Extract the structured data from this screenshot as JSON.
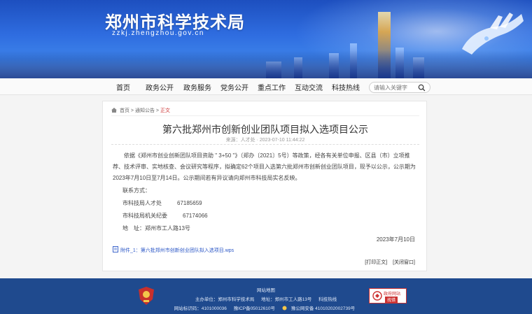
{
  "header": {
    "title": "郑州市科学技术局",
    "domain": "zzkj.zhengzhou.gov.cn"
  },
  "nav": {
    "items": [
      "首页",
      "政务公开",
      "政务服务",
      "党务公开",
      "重点工作",
      "互动交流",
      "科技热线"
    ],
    "search_placeholder": "请输入关键字"
  },
  "breadcrumb": {
    "home": "首页",
    "section": "通知公告",
    "current": "正文",
    "sep": ">"
  },
  "article": {
    "title": "第六批郑州市创新创业团队项目拟入选项目公示",
    "meta": "来源：人才处 · 2023-07-10 11:44:22",
    "body": "依据《郑州市创业创新团队项目资助 \" 3+50 \"》（郑办〔2021〕5号）等政策，经各有关单位申报、区县（市）立项推荐、技术评审、实地核查、会议研究等程序，拟确定62个项目入选第六批郑州市创新创业团队项目，现予以公示，公示期为2023年7月10日至7月14日。公示期间若有异议请向郑州市科技局实名反映。",
    "contact_label": "联系方式：",
    "contacts": [
      {
        "name": "市科技局人才处",
        "phone": "67185659"
      },
      {
        "name": "市科技局机关纪委",
        "phone": "67174066"
      }
    ],
    "address": "地　址：郑州市工人路13号",
    "date": "2023年7月10日",
    "attachment": "附件_1：第六批郑州市创新创业团队拟入选项目.wps",
    "print": "[打印正文]",
    "close": "[关闭窗口]"
  },
  "footer": {
    "sitemap": "网站地图",
    "host": "主办单位：郑州市科学技术局",
    "address": "地址：郑州市工人路13号",
    "hotline": "科技热线",
    "code": "网站标识码：4101000036",
    "icp": "豫ICP备05012610号",
    "police": "豫公网安备 41010202002739号",
    "gov_top": "政府网站",
    "gov_bottom": "找错"
  },
  "colors": {
    "banner": "#2f6de0",
    "footer": "#1f4a8e",
    "accent_red": "#cc3333",
    "link_blue": "#2a56c6"
  }
}
